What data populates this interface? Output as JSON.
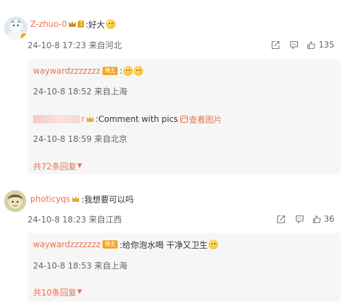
{
  "comments": [
    {
      "username": "Z-zhuo-0",
      "level": "1",
      "text": ":好大",
      "date": "24-10-8 17:23 来自河北",
      "likes": "135",
      "replies": [
        {
          "username": "waywardzzzzzzz",
          "badge": "博主",
          "text": ":",
          "date": "24-10-8 18:52 来自上海"
        },
        {
          "username": "r",
          "text": ":Comment with pics",
          "view_pics": "查看图片",
          "date": "24-10-8 18:59 来自北京"
        }
      ],
      "more": "共72条回复"
    },
    {
      "username": "photicyqs",
      "text": ":我想要可以吗",
      "date": "24-10-8 18:23 来自江西",
      "likes": "36",
      "replies": [
        {
          "username": "waywardzzzzzzz",
          "badge": "博主",
          "text": ":给你泡水喝 干净又卫生",
          "date": "24-10-8 18:53 来自上海"
        }
      ],
      "more": "共10条回复"
    }
  ],
  "colors": {
    "accent": "#eb7350",
    "meta": "#666666",
    "thread_bg": "#f6f6f6"
  }
}
